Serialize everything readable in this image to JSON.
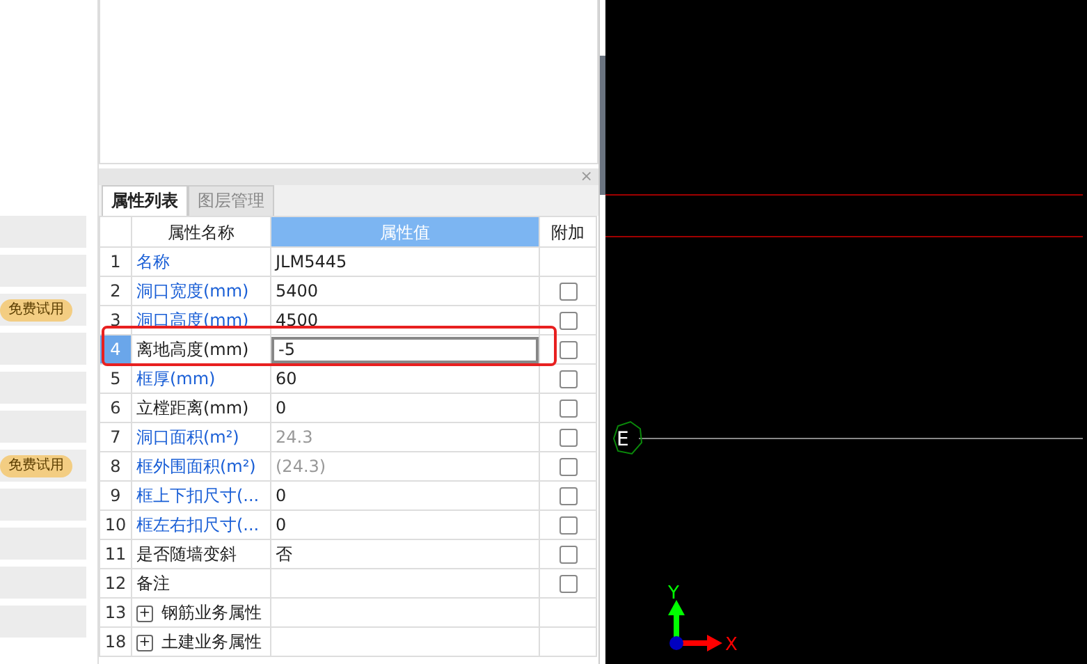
{
  "side_strip": [
    {
      "kind": "plain"
    },
    {
      "kind": "plain"
    },
    {
      "kind": "trial",
      "badge": "免费试用"
    },
    {
      "kind": "plain"
    },
    {
      "kind": "plain"
    },
    {
      "kind": "plain"
    },
    {
      "kind": "trial",
      "badge": "免费试用"
    },
    {
      "kind": "plain"
    },
    {
      "kind": "plain"
    },
    {
      "kind": "plain"
    },
    {
      "kind": "plain"
    }
  ],
  "panel": {
    "close": "×",
    "tabs": [
      {
        "label": "属性列表",
        "selected": true
      },
      {
        "label": "图层管理",
        "selected": false
      }
    ],
    "columns": [
      "属性名称",
      "属性值",
      "附加"
    ],
    "rows": [
      {
        "num": "1",
        "name": "名称",
        "color": "#1a5fd6",
        "value": "JLM5445",
        "muted": false,
        "selected": false
      },
      {
        "num": "2",
        "name": "洞口宽度(mm)",
        "color": "#1a5fd6",
        "value": "5400",
        "muted": false,
        "selected": false,
        "checked": false
      },
      {
        "num": "3",
        "name": "洞口高度(mm)",
        "color": "#1a5fd6",
        "value": "4500",
        "muted": false,
        "selected": false,
        "checked": false
      },
      {
        "num": "4",
        "name": "离地高度(mm)",
        "color": "#222222",
        "value": "-5",
        "muted": false,
        "selected": true,
        "checked": false
      },
      {
        "num": "5",
        "name": "框厚(mm)",
        "color": "#1a5fd6",
        "value": "60",
        "muted": false,
        "selected": false,
        "checked": false
      },
      {
        "num": "6",
        "name": "立樘距离(mm)",
        "color": "#222222",
        "value": "0",
        "muted": false,
        "selected": false,
        "checked": false
      },
      {
        "num": "7",
        "name": "洞口面积(m²)",
        "color": "#1a5fd6",
        "value": "24.3",
        "muted": true,
        "selected": false,
        "checked": false
      },
      {
        "num": "8",
        "name": "框外围面积(m²)",
        "color": "#1a5fd6",
        "value": "(24.3)",
        "muted": true,
        "selected": false,
        "checked": false
      },
      {
        "num": "9",
        "name": "框上下扣尺寸(...",
        "color": "#1a5fd6",
        "value": "0",
        "muted": false,
        "selected": false,
        "checked": false
      },
      {
        "num": "10",
        "name": "框左右扣尺寸(...",
        "color": "#1a5fd6",
        "value": "0",
        "muted": false,
        "selected": false,
        "checked": false
      },
      {
        "num": "11",
        "name": "是否随墙变斜",
        "color": "#222222",
        "value": "否",
        "muted": false,
        "selected": false,
        "checked": false
      },
      {
        "num": "12",
        "name": "备注",
        "color": "#222222",
        "value": "",
        "muted": false,
        "selected": false,
        "checked": false
      },
      {
        "kind": "group",
        "num": "13",
        "name": "钢筋业务属性",
        "color": "#222222",
        "expanded": false,
        "toggle": "+",
        "selected": false
      },
      {
        "kind": "group",
        "num": "18",
        "name": "土建业务属性",
        "color": "#222222",
        "expanded": false,
        "toggle": "+",
        "selected": false
      }
    ]
  },
  "canvas": {
    "marker": "E",
    "axis_x": "X",
    "axis_y": "Y"
  }
}
